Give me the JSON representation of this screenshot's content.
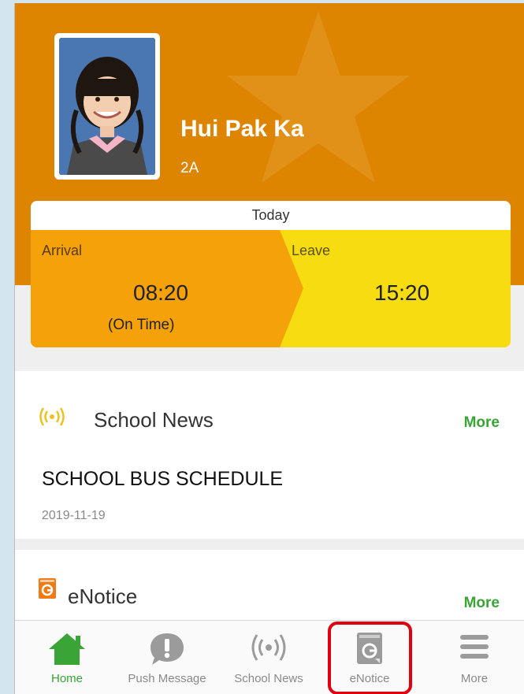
{
  "student": {
    "name": "Hui Pak Ka",
    "class": "2A"
  },
  "attendance": {
    "heading": "Today",
    "arrival_label": "Arrival",
    "arrival_time": "08:20",
    "arrival_status": "(On Time)",
    "leave_label": "Leave",
    "leave_time": "15:20"
  },
  "school_news": {
    "title": "School News",
    "more_label": "More",
    "headline": "SCHOOL BUS SCHEDULE",
    "date": "2019-11-19"
  },
  "enotice": {
    "title": "eNotice",
    "more_label": "More"
  },
  "tabs": [
    {
      "label": "Home",
      "icon": "home-icon",
      "active": true
    },
    {
      "label": "Push Message",
      "icon": "push-message-icon",
      "active": false
    },
    {
      "label": "School News",
      "icon": "broadcast-icon",
      "active": false
    },
    {
      "label": "eNotice",
      "icon": "enotice-icon",
      "active": false
    },
    {
      "label": "More",
      "icon": "menu-icon",
      "active": false
    }
  ],
  "colors": {
    "header_bg": "#dd8400",
    "arrival_bg": "#f5a10a",
    "leave_bg": "#f6dc10",
    "accent_green": "#3aa437",
    "highlight_red": "#e0000f"
  }
}
